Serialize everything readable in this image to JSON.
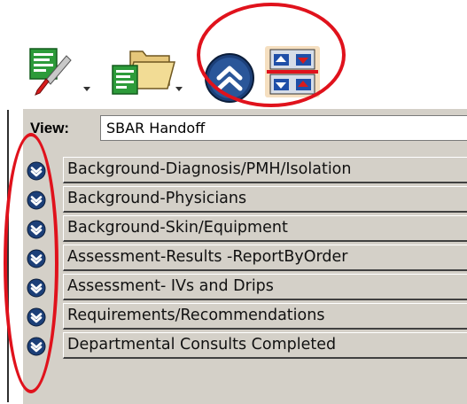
{
  "toolbar": {
    "tools": [
      {
        "icon": "edit-form-icon",
        "has_dropdown": true
      },
      {
        "icon": "folder-form-icon",
        "has_dropdown": true
      },
      {
        "icon": "collapse-all-icon",
        "has_dropdown": false
      },
      {
        "icon": "expand-collapse-arrows-icon",
        "has_dropdown": false
      }
    ]
  },
  "view": {
    "label": "View:",
    "value": "SBAR Handoff"
  },
  "sections": [
    {
      "label": "Background-Diagnosis/PMH/Isolation"
    },
    {
      "label": "Background-Physicians"
    },
    {
      "label": "Background-Skin/Equipment"
    },
    {
      "label": "Assessment-Results -ReportByOrder"
    },
    {
      "label": "Assessment- IVs and Drips"
    },
    {
      "label": "Requirements/Recommendations"
    },
    {
      "label": "Departmental Consults Completed"
    }
  ],
  "colors": {
    "annotation": "#e0121c",
    "panel": "#d4d0c8",
    "chevron": "#1c3f78"
  }
}
